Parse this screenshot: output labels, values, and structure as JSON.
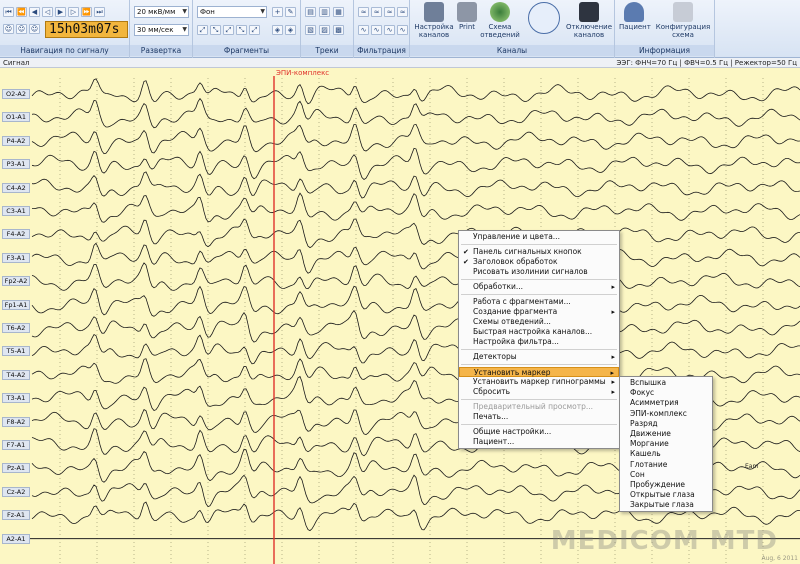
{
  "ribbon": {
    "groups": {
      "navigation": "Навигация по сигналу",
      "sweep": "Развертка",
      "fragments": "Фрагменты",
      "tracks": "Треки",
      "filtration": "Фильтрация",
      "channels": "Каналы",
      "information": "Информация"
    },
    "time": "15h03m07s",
    "sensitivity": "20 мкВ/мм",
    "speed": "30 мм/сек",
    "fragment_select": "Фон",
    "buttons": {
      "channel_settings": "Настройка каналов",
      "print": "Print",
      "montage_scheme": "Схема отведений",
      "disconnect_channels": "Отключение каналов",
      "patient": "Пациент",
      "config_scheme": "Конфигурация схема"
    }
  },
  "signal": {
    "title": "Сигнал",
    "filters": "ЭЭГ: ФНЧ=70 Гц | ФВЧ=0.5 Гц | Режектор=50 Гц",
    "marker_label": "ЭПИ-комплекс",
    "channels": [
      "O2-A2",
      "O1-A1",
      "P4-A2",
      "P3-A1",
      "C4-A2",
      "C3-A1",
      "F4-A2",
      "F3-A1",
      "Fp2-A2",
      "Fp1-A1",
      "T6-A2",
      "T5-A1",
      "T4-A2",
      "T3-A1",
      "F8-A2",
      "F7-A1",
      "Pz-A1",
      "Cz-A2",
      "Fz-A1",
      "A2-A1"
    ],
    "annotation": "Eam"
  },
  "context_menu": {
    "items": [
      {
        "label": "Управление и цвета...",
        "type": "item"
      },
      {
        "type": "sep"
      },
      {
        "label": "Панель сигнальных кнопок",
        "type": "check"
      },
      {
        "label": "Заголовок обработок",
        "type": "check"
      },
      {
        "label": "Рисовать изолинии сигналов",
        "type": "item"
      },
      {
        "type": "sep"
      },
      {
        "label": "Обработки...",
        "type": "sub"
      },
      {
        "type": "sep"
      },
      {
        "label": "Работа с фрагментами...",
        "type": "item"
      },
      {
        "label": "Создание фрагмента",
        "type": "sub"
      },
      {
        "label": "Схемы отведений...",
        "type": "item"
      },
      {
        "label": "Быстрая настройка каналов...",
        "type": "item"
      },
      {
        "label": "Настройка фильтра...",
        "type": "item"
      },
      {
        "type": "sep"
      },
      {
        "label": "Детекторы",
        "type": "sub"
      },
      {
        "type": "sep"
      },
      {
        "label": "Установить маркер",
        "type": "sub-active"
      },
      {
        "label": "Установить маркер гипнограммы",
        "type": "sub"
      },
      {
        "label": "Сбросить",
        "type": "sub"
      },
      {
        "type": "sep"
      },
      {
        "label": "Предварительный просмотр...",
        "type": "disabled"
      },
      {
        "label": "Печать...",
        "type": "item"
      },
      {
        "type": "sep"
      },
      {
        "label": "Общие настройки...",
        "type": "item"
      },
      {
        "label": "Пациент...",
        "type": "item"
      }
    ],
    "submenu": [
      "Вспышка",
      "Фокус",
      "Асимметрия",
      "ЭПИ-комплекс",
      "Разряд",
      "Движение",
      "Моргание",
      "Кашель",
      "Глотание",
      "Сон",
      "Пробуждение",
      "Открытые глаза",
      "Закрытые глаза"
    ]
  },
  "watermark": {
    "brand": "MEDICOM MTD",
    "date": "Aug, 6 2011"
  },
  "colors": {
    "chart_bg": "#fcf7c4",
    "marker": "#e0332c",
    "menu_highlight": "#f5b54a"
  }
}
